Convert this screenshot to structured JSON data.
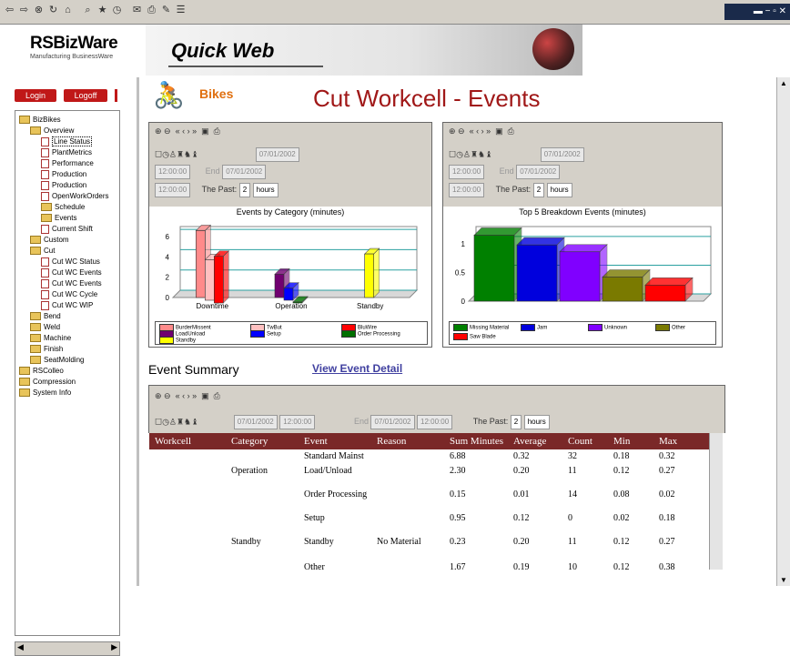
{
  "browser_toolbar": {
    "icons": [
      "back-icon",
      "forward-icon",
      "stop-icon",
      "refresh-icon",
      "home-icon",
      "search-icon",
      "favorites-icon",
      "history-icon",
      "mail-icon",
      "print-icon",
      "edit-icon",
      "discuss-icon"
    ]
  },
  "header": {
    "brand": "RSBizWare",
    "brand_sub": "Manufacturing BusinessWare",
    "product": "Quick Web"
  },
  "left_nav": {
    "login": "Login",
    "logoff": "Logoff",
    "tree": [
      {
        "label": "BizBikes",
        "kind": "folder",
        "depth": 0
      },
      {
        "label": "Overview",
        "kind": "folder",
        "depth": 1
      },
      {
        "label": "Line Status",
        "kind": "page",
        "depth": 2,
        "selected": true
      },
      {
        "label": "PlantMetrics",
        "kind": "page",
        "depth": 2
      },
      {
        "label": "Performance",
        "kind": "page",
        "depth": 2
      },
      {
        "label": "Production",
        "kind": "page",
        "depth": 2
      },
      {
        "label": "Production",
        "kind": "page",
        "depth": 2
      },
      {
        "label": "OpenWorkOrders",
        "kind": "page",
        "depth": 2
      },
      {
        "label": "Schedule",
        "kind": "folder",
        "depth": 2
      },
      {
        "label": "Events",
        "kind": "folder",
        "depth": 2
      },
      {
        "label": "Current Shift",
        "kind": "page",
        "depth": 2
      },
      {
        "label": "Custom",
        "kind": "folder",
        "depth": 1
      },
      {
        "label": "Cut",
        "kind": "folder",
        "depth": 1
      },
      {
        "label": "Cut WC Status",
        "kind": "page",
        "depth": 2
      },
      {
        "label": "Cut WC Events",
        "kind": "page",
        "depth": 2
      },
      {
        "label": "Cut WC Events",
        "kind": "page",
        "depth": 2
      },
      {
        "label": "Cut WC Cycle",
        "kind": "page",
        "depth": 2
      },
      {
        "label": "Cut WC WIP",
        "kind": "page",
        "depth": 2
      },
      {
        "label": "Bend",
        "kind": "folder",
        "depth": 1
      },
      {
        "label": "Weld",
        "kind": "folder",
        "depth": 1
      },
      {
        "label": "Machine",
        "kind": "folder",
        "depth": 1
      },
      {
        "label": "Finish",
        "kind": "folder",
        "depth": 1
      },
      {
        "label": "SeatMolding",
        "kind": "folder",
        "depth": 1
      },
      {
        "label": "RSColleo",
        "kind": "folder",
        "depth": 0
      },
      {
        "label": "Compression",
        "kind": "folder",
        "depth": 0
      },
      {
        "label": "System Info",
        "kind": "folder",
        "depth": 0
      }
    ]
  },
  "page": {
    "logo_text": "Bikes",
    "title": "Cut Workcell - Events"
  },
  "panel_toolbar": {
    "icons": [
      "zoom-in-icon",
      "zoom-out-icon",
      "first-icon",
      "prev-icon",
      "next-icon",
      "last-icon",
      "save-icon",
      "print-icon"
    ],
    "start_date": "07/01/2002",
    "start_time": "12:00:00",
    "end_label": "End",
    "end_date": "07/01/2002",
    "end_time": "12:00:00",
    "past_label": "The Past:",
    "past_value": "2",
    "past_unit": "hours"
  },
  "chart_data": [
    {
      "type": "bar",
      "title": "Events by Category (minutes)",
      "categories": [
        "Downtime",
        "Operation",
        "Standby"
      ],
      "ylim": [
        0,
        7
      ],
      "yticks": [
        0,
        2,
        4,
        6
      ],
      "series": [
        {
          "name": "BurderMissent",
          "color": "#ff8a8a",
          "values": [
            6.6,
            0,
            0
          ]
        },
        {
          "name": "TwBut",
          "color": "#ffc0c0",
          "values": [
            4.0,
            0,
            0
          ]
        },
        {
          "name": "BluWire",
          "color": "#ff0000",
          "values": [
            4.6,
            0,
            0
          ]
        },
        {
          "name": "LoadUnload",
          "color": "#700070",
          "values": [
            0,
            2.3,
            0
          ]
        },
        {
          "name": "Setup",
          "color": "#0000ff",
          "values": [
            0,
            1.2,
            0
          ]
        },
        {
          "name": "Order Processing",
          "color": "#007000",
          "values": [
            0,
            0.1,
            0
          ]
        },
        {
          "name": "Standby",
          "color": "#ffff00",
          "values": [
            0,
            0,
            4.3
          ]
        }
      ]
    },
    {
      "type": "bar",
      "title": "Top 5 Breakdown Events (minutes)",
      "categories": [
        "Missing Material",
        "Jam",
        "Unknown",
        "Other",
        "Saw Blade"
      ],
      "ylim": [
        0,
        1.3
      ],
      "yticks": [
        0,
        0.5,
        1
      ],
      "values": [
        1.15,
        0.98,
        0.86,
        0.42,
        0.28
      ],
      "colors": [
        "#008000",
        "#0000dd",
        "#8000ff",
        "#7a7a00",
        "#ff0000"
      ]
    }
  ],
  "summary": {
    "heading": "Event Summary",
    "link": "View Event Detail"
  },
  "table": {
    "columns": [
      "Workcell",
      "Category",
      "Event",
      "Reason",
      "Sum Minutes",
      "Average",
      "Count",
      "Min",
      "Max"
    ],
    "rows": [
      [
        "",
        "",
        "Standard Mainst",
        "",
        "6.88",
        "0.32",
        "32",
        "0.18",
        "0.32"
      ],
      [
        "",
        "Operation",
        "Load/Unload",
        "",
        "2.30",
        "0.20",
        "11",
        "0.12",
        "0.27"
      ],
      [
        "",
        "",
        "Order Processing",
        "",
        "0.15",
        "0.01",
        "14",
        "0.08",
        "0.02"
      ],
      [
        "",
        "",
        "Setup",
        "",
        "0.95",
        "0.12",
        "0",
        "0.02",
        "0.18"
      ],
      [
        "",
        "Standby",
        "Standby",
        "No Material",
        "0.23",
        "0.20",
        "11",
        "0.12",
        "0.27"
      ],
      [
        "",
        "",
        "Other",
        "",
        "1.67",
        "0.19",
        "10",
        "0.12",
        "0.38"
      ]
    ]
  }
}
